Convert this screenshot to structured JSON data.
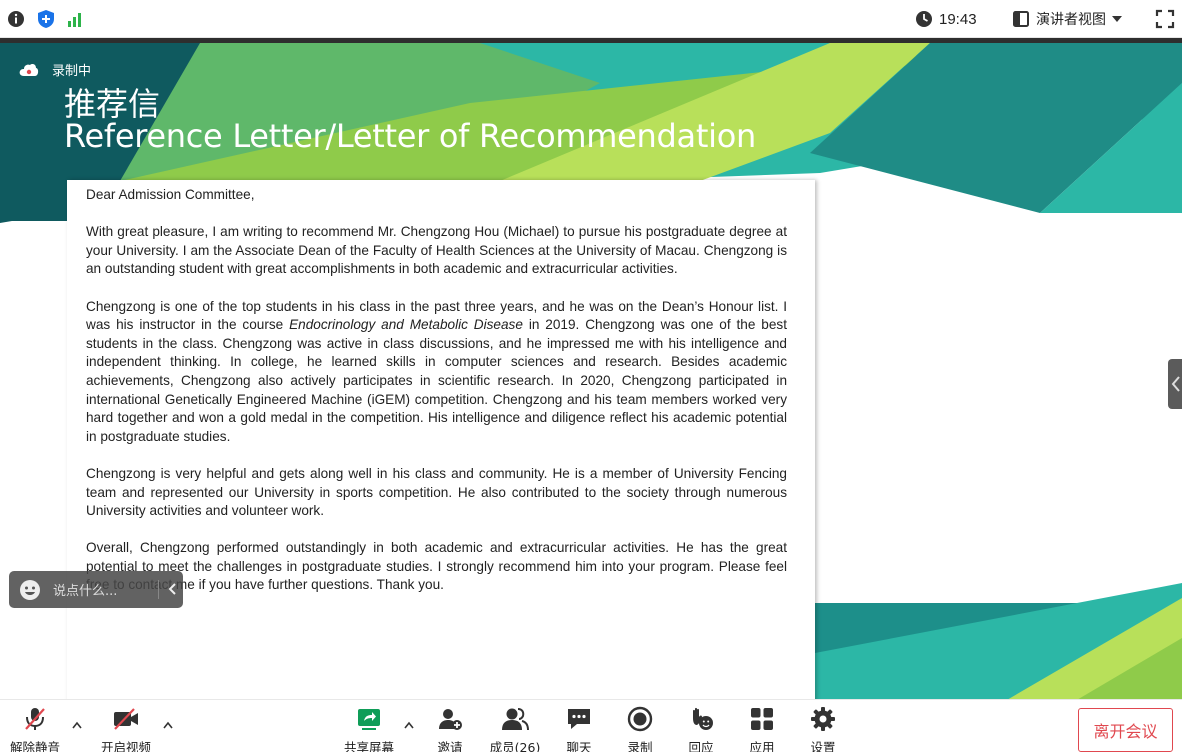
{
  "status_bar": {
    "icons": [
      "info-icon",
      "shield-icon",
      "signal-icon"
    ],
    "time": "19:43",
    "view_mode": "演讲者视图",
    "fullscreen_icon": "fullscreen-icon"
  },
  "recording": {
    "label": "录制中",
    "icon": "cloud-record-icon"
  },
  "slide": {
    "title_cn": "推荐信",
    "title_en": "Reference Letter/Letter of Recommendation",
    "colors": {
      "teal_dark": "#0f5a5f",
      "teal": "#2cb7a6",
      "lime": "#8fcb4a",
      "lime_light": "#b8e05a"
    },
    "letter": {
      "greeting": "Dear Admission Committee,",
      "p1": "With great pleasure, I am writing to recommend Mr. Chengzong Hou (Michael) to pursue his postgraduate degree at your University. I am the Associate Dean of the Faculty of Health Sciences at the University of Macau. Chengzong is an outstanding student with great accomplishments in both academic and extracurricular activities.",
      "p2_a": "Chengzong is one of the top students in his class in the past three years, and he was on the Dean’s Honour list. I was his instructor in the course ",
      "p2_course": "Endocrinology and Metabolic Disease",
      "p2_b": " in 2019. Chengzong was one of the best students in the class. Chengzong was active in class discussions, and he impressed me with his intelligence and independent thinking. In college, he learned skills in computer sciences and research. Besides academic achievements, Chengzong also actively participates in scientific research. In 2020, Chengzong participated in international Genetically Engineered Machine (iGEM) competition. Chengzong and his team members worked very hard together and won a gold medal in the competition. His intelligence and diligence reflect his academic potential in postgraduate studies.",
      "p3": "Chengzong is very helpful and gets along well in his class and community. He is a member of University Fencing team and represented our University in sports competition. He also contributed to the society through numerous University activities and volunteer work.",
      "p4": "Overall, Chengzong performed outstandingly in both academic and extracurricular activities. He has the great potential to meet the challenges in postgraduate studies. I strongly recommend him into your program. Please feel free to contact me if you have further questions. Thank you."
    }
  },
  "chat": {
    "placeholder": "说点什么...",
    "emoji_icon": "emoji-icon",
    "collapse_icon": "chevron-left-icon"
  },
  "toolbar": {
    "unmute": "解除静音",
    "start_video": "开启视频",
    "share_screen": "共享屏幕",
    "invite": "邀请",
    "members": "成员(26)",
    "chat": "聊天",
    "record": "录制",
    "react": "回应",
    "apps": "应用",
    "settings": "设置",
    "leave": "离开会议",
    "accent": "#0f9d58",
    "danger": "#e0484f"
  }
}
